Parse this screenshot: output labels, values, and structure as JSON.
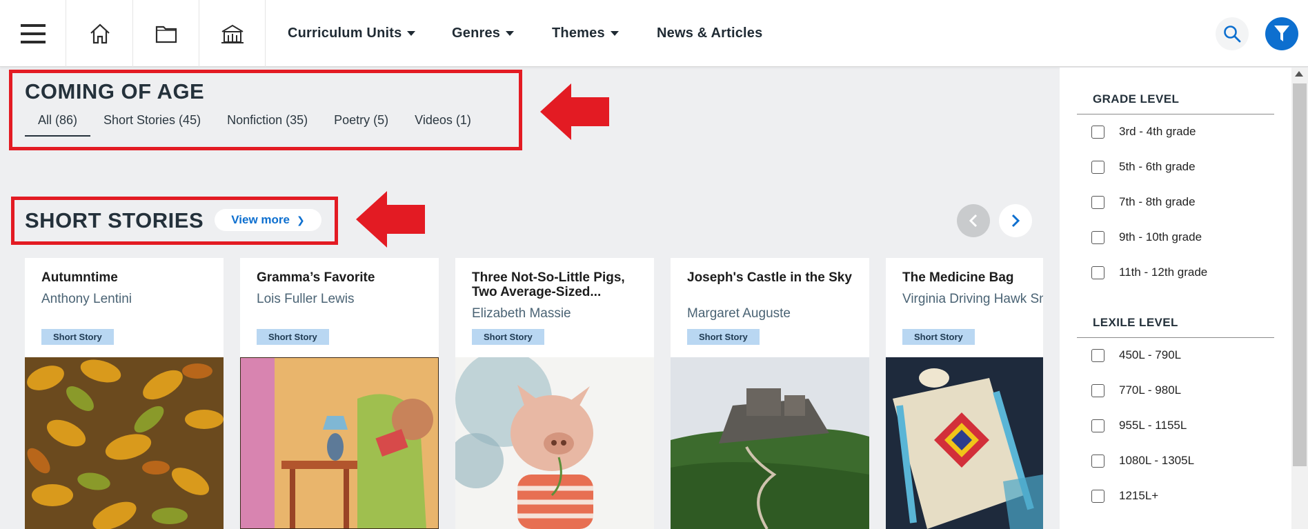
{
  "nav": {
    "items": [
      {
        "label": "Curriculum Units",
        "has_dropdown": true
      },
      {
        "label": "Genres",
        "has_dropdown": true
      },
      {
        "label": "Themes",
        "has_dropdown": true
      },
      {
        "label": "News & Articles",
        "has_dropdown": false
      }
    ],
    "icons": [
      "menu-icon",
      "home-icon",
      "folder-icon",
      "library-icon",
      "search-icon",
      "filter-icon"
    ]
  },
  "theme": {
    "title": "COMING OF AGE",
    "tabs": [
      {
        "label": "All (86)",
        "active": true
      },
      {
        "label": "Short Stories (45)",
        "active": false
      },
      {
        "label": "Nonfiction (35)",
        "active": false
      },
      {
        "label": "Poetry (5)",
        "active": false
      },
      {
        "label": "Videos (1)",
        "active": false
      }
    ]
  },
  "short_stories": {
    "title": "SHORT STORIES",
    "view_more": "View more",
    "cards": [
      {
        "title": "Autumntime",
        "author": "Anthony Lentini",
        "badge": "Short Story",
        "image": "autumn-leaves"
      },
      {
        "title": "Gramma’s Favorite",
        "author": "Lois Fuller Lewis",
        "badge": "Short Story",
        "image": "illustration-living-room"
      },
      {
        "title": "Three Not-So-Little Pigs, Two Average-Sized...",
        "author": "Elizabeth Massie",
        "badge": "Short Story",
        "image": "illustration-pig"
      },
      {
        "title": "Joseph's Castle in the Sky",
        "author": "Margaret Auguste",
        "badge": "Short Story",
        "image": "hilltop-fortress"
      },
      {
        "title": "The Medicine Bag",
        "author": "Virginia Driving Hawk Sneve",
        "badge": "Short Story",
        "image": "beaded-bag"
      }
    ]
  },
  "filters": {
    "grade_level": {
      "heading": "GRADE LEVEL",
      "options": [
        "3rd - 4th grade",
        "5th - 6th grade",
        "7th - 8th grade",
        "9th - 10th grade",
        "11th - 12th grade"
      ]
    },
    "lexile_level": {
      "heading": "LEXILE LEVEL",
      "options": [
        "450L - 790L",
        "770L - 980L",
        "955L - 1155L",
        "1080L - 1305L",
        "1215L+"
      ]
    }
  },
  "colors": {
    "accent": "#0d6fcf",
    "annotation_red": "#e31b23",
    "badge_bg": "#b9d7f2",
    "page_bg": "#eeeff1"
  }
}
